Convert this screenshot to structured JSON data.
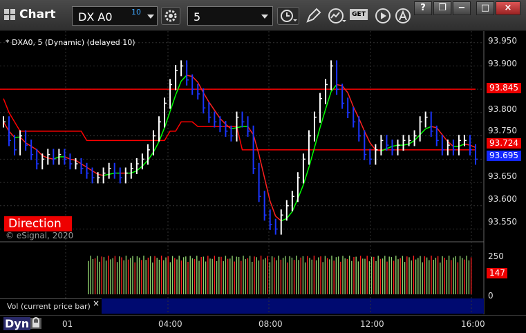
{
  "window": {
    "title": "Chart",
    "close_glyph": "×",
    "help_glyph": "?",
    "restore_glyph": "❐",
    "max_glyph": "□",
    "min_glyph": "−"
  },
  "toolbar": {
    "symbol": "DX A0",
    "symbol_badge": "10",
    "interval": "5",
    "get_label": "GET"
  },
  "study": {
    "label": "* DXA0, 5 (Dynamic) (delayed 10)",
    "copyright": "© eSignal, 2020",
    "direction": "Direction"
  },
  "price_axis": {
    "ticks": [
      "93.950",
      "93.900",
      "93.850",
      "93.800",
      "93.750",
      "93.700",
      "93.650",
      "93.600",
      "93.550"
    ],
    "tags": {
      "upper_red": "93.845",
      "mid_red": "93.724",
      "last": "93.695"
    }
  },
  "volume_axis": {
    "ticks": [
      "250",
      "0"
    ],
    "tag": "147"
  },
  "volume_panel": {
    "label": "Vol (current price bar)",
    "close": "×"
  },
  "time_axis": {
    "labels": [
      "01",
      "04:00",
      "08:00",
      "12:00",
      "16:00"
    ]
  },
  "bottom": {
    "dyn": "Dyn"
  },
  "colors": {
    "up": "#00ff00",
    "down": "#ff2020",
    "bar_up": "#ffffff",
    "bar_down": "#1a35ff",
    "red_line": "#ff0000",
    "green_line": "#00dd00",
    "blue_tag": "#1428ff"
  },
  "chart_data": {
    "type": "line",
    "ylim": [
      93.53,
      93.96
    ],
    "close": [
      93.78,
      93.74,
      93.72,
      93.75,
      93.73,
      93.71,
      93.69,
      93.7,
      93.71,
      93.7,
      93.71,
      93.7,
      93.69,
      93.69,
      93.68,
      93.67,
      93.66,
      93.66,
      93.67,
      93.68,
      93.67,
      93.66,
      93.67,
      93.68,
      93.69,
      93.7,
      93.72,
      93.75,
      93.78,
      93.82,
      93.86,
      93.89,
      93.9,
      93.87,
      93.85,
      93.84,
      93.81,
      93.79,
      93.78,
      93.77,
      93.76,
      93.75,
      93.79,
      93.78,
      93.76,
      93.68,
      93.62,
      93.58,
      93.56,
      93.55,
      93.58,
      93.6,
      93.62,
      93.66,
      93.7,
      93.75,
      93.79,
      93.83,
      93.86,
      93.9,
      93.85,
      93.82,
      93.8,
      93.78,
      93.75,
      93.71,
      93.7,
      93.72,
      93.74,
      93.73,
      93.72,
      93.73,
      93.74,
      93.74,
      93.75,
      93.78,
      93.79,
      93.76,
      93.74,
      93.72,
      93.73,
      93.72,
      93.74,
      93.74,
      93.72,
      93.7
    ],
    "upper_line": [
      93.85,
      93.85,
      93.85,
      93.85,
      93.85,
      93.85,
      93.85,
      93.85,
      93.85,
      93.85,
      93.85,
      93.85,
      93.85,
      93.85,
      93.85,
      93.85,
      93.85,
      93.85,
      93.85,
      93.85,
      93.85,
      93.85,
      93.85,
      93.85,
      93.85,
      93.85,
      93.85,
      93.85,
      93.85,
      93.85,
      93.85,
      93.85,
      93.85,
      93.85,
      93.85,
      93.85,
      93.85,
      93.85,
      93.85,
      93.85,
      93.85,
      93.85,
      93.85,
      93.85,
      93.85,
      93.85,
      93.85,
      93.85,
      93.85,
      93.85,
      93.85,
      93.85,
      93.85,
      93.85,
      93.85,
      93.85,
      93.85,
      93.85,
      93.85,
      93.85,
      93.85,
      93.85,
      93.85,
      93.85,
      93.85,
      93.85,
      93.85,
      93.85,
      93.85,
      93.85,
      93.85,
      93.85,
      93.85,
      93.85,
      93.85,
      93.85,
      93.85,
      93.85,
      93.85,
      93.85,
      93.85,
      93.85,
      93.85,
      93.85,
      93.85,
      93.85
    ],
    "red_step": [
      93.83,
      93.8,
      93.78,
      93.76,
      93.76,
      93.76,
      93.76,
      93.76,
      93.76,
      93.76,
      93.76,
      93.76,
      93.76,
      93.76,
      93.76,
      93.74,
      93.74,
      93.74,
      93.74,
      93.74,
      93.74,
      93.74,
      93.74,
      93.74,
      93.74,
      93.74,
      93.74,
      93.74,
      93.74,
      93.74,
      93.76,
      93.76,
      93.78,
      93.78,
      93.78,
      93.77,
      93.77,
      93.77,
      93.77,
      93.77,
      93.77,
      93.77,
      93.77,
      93.72,
      93.72,
      93.72,
      93.72,
      93.72,
      93.72,
      93.72,
      93.72,
      93.72,
      93.72,
      93.72,
      93.72,
      93.72,
      93.72,
      93.72,
      93.72,
      93.72,
      93.72,
      93.72,
      93.72,
      93.72,
      93.72,
      93.72,
      93.72,
      93.72,
      93.72,
      93.72,
      93.72,
      93.72,
      93.72,
      93.72,
      93.72,
      93.72,
      93.72,
      93.72,
      93.72,
      93.72,
      93.72,
      93.72,
      93.72,
      93.72,
      93.72,
      93.72
    ]
  }
}
